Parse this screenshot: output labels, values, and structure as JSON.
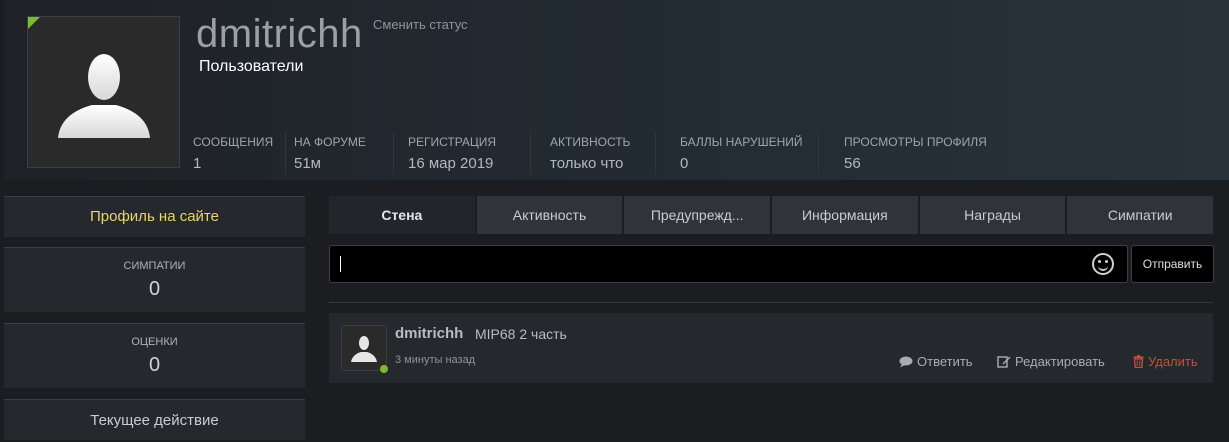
{
  "profile": {
    "username": "dmitrichh",
    "change_status": "Сменить статус",
    "group": "Пользователи",
    "stats": [
      {
        "label": "Сообщения",
        "value": "1"
      },
      {
        "label": "На форуме",
        "value": "51м"
      },
      {
        "label": "Регистрация",
        "value": "16 мар 2019"
      },
      {
        "label": "Активность",
        "value": "только что"
      },
      {
        "label": "Баллы нарушений",
        "value": "0"
      },
      {
        "label": "Просмотры профиля",
        "value": "56"
      }
    ]
  },
  "sidebar": {
    "profile_link": "Профиль на сайте",
    "likes": {
      "label": "Симпатии",
      "value": "0"
    },
    "ratings": {
      "label": "Оценки",
      "value": "0"
    },
    "current_action": "Текущее действие"
  },
  "tabs": [
    {
      "label": "Стена"
    },
    {
      "label": "Активность"
    },
    {
      "label": "Предупрежд..."
    },
    {
      "label": "Информация"
    },
    {
      "label": "Награды"
    },
    {
      "label": "Симпатии"
    }
  ],
  "composer": {
    "value": "",
    "send_label": "Отправить"
  },
  "post": {
    "author": "dmitrichh",
    "text": "MIP68 2 часть",
    "time": "3 минуты назад",
    "reply_label": "Ответить",
    "edit_label": "Редактировать",
    "delete_label": "Удалить"
  },
  "colors": {
    "online": "#7cbb2e",
    "profile_link": "#e8d56a",
    "delete": "#cf4a3f"
  }
}
